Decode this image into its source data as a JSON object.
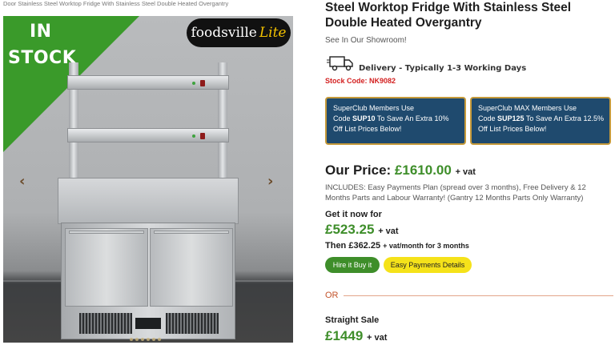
{
  "breadcrumb": "Door Stainless Steel Worktop Fridge With Stainless Steel Double Heated Overgantry",
  "gallery": {
    "stock_badge_line1": "IN",
    "stock_badge_line2": "STOCK",
    "logo_main": "foodsville",
    "logo_accent": "Lite",
    "prev_arrow": "‹",
    "next_arrow": "›",
    "dot_count": 6,
    "colors": {
      "badge_green": "#3a9a2a",
      "logo_accent": "#f2c100"
    }
  },
  "product": {
    "title": "Steel Worktop Fridge With Stainless Steel Double Heated Overgantry",
    "showroom": "See In Our Showroom!",
    "delivery_icon": "truck-icon",
    "delivery": "Delivery - Typically 1-3 Working Days",
    "stock_code": "Stock Code: NK9082"
  },
  "promos": [
    {
      "line1": "SuperClub Members Use",
      "code_prefix": "Code ",
      "code": "SUP10",
      "code_suffix": " To Save An Extra 10%",
      "line3": "Off List Prices Below!"
    },
    {
      "line1": "SuperClub MAX Members Use",
      "code_prefix": "Code ",
      "code": "SUP125",
      "code_suffix": " To Save An Extra 12.5%",
      "line3": "Off List Prices Below!"
    }
  ],
  "pricing": {
    "our_price_label": "Our Price: ",
    "our_price": "£1610.00",
    "vat": "+ vat",
    "includes": "INCLUDES: Easy Payments Plan (spread over 3 months), Free Delivery & 12 Months Parts and Labour Warranty! (Gantry 12 Months Parts Only Warranty)",
    "get_now_label": "Get it now for",
    "deposit": "£523.25",
    "monthly_prefix": "Then £362.25 ",
    "monthly_suffix": "+ vat/month for 3 months",
    "hire_button": "Hire it Buy it",
    "easy_button": "Easy Payments Details",
    "or": "OR",
    "straight_label": "Straight Sale",
    "straight_price": "£1449"
  }
}
